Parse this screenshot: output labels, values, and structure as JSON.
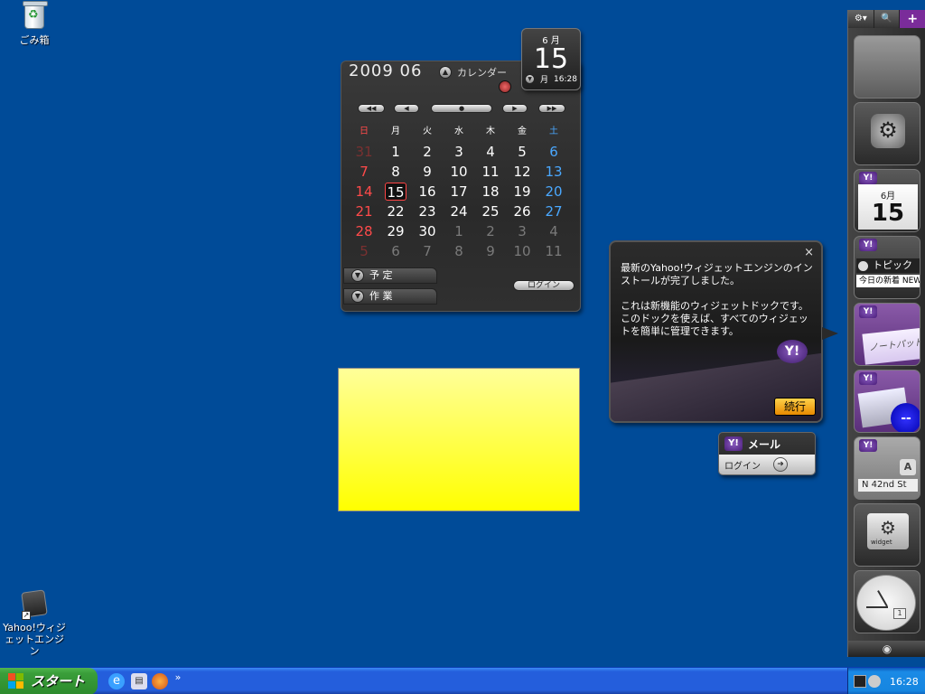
{
  "desktop": {
    "icons": [
      {
        "label": "ごみ箱",
        "icon": "recycle-bin-icon"
      },
      {
        "label": "Yahoo!ウィジェットエンジン",
        "icon": "yahoo-widgets-icon"
      }
    ]
  },
  "calendar": {
    "year_month": "2009 06",
    "mode_label": "カレンダー",
    "weekdays": [
      "日",
      "月",
      "火",
      "水",
      "木",
      "金",
      "土"
    ],
    "weeks": [
      [
        "31",
        "1",
        "2",
        "3",
        "4",
        "5",
        "6"
      ],
      [
        "7",
        "8",
        "9",
        "10",
        "11",
        "12",
        "13"
      ],
      [
        "14",
        "15",
        "16",
        "17",
        "18",
        "19",
        "20"
      ],
      [
        "21",
        "22",
        "23",
        "24",
        "25",
        "26",
        "27"
      ],
      [
        "28",
        "29",
        "30",
        "1",
        "2",
        "3",
        "4"
      ],
      [
        "5",
        "6",
        "7",
        "8",
        "9",
        "10",
        "11"
      ]
    ],
    "today": "15",
    "tab_schedule": "予 定",
    "tab_tasks": "作 業",
    "login_label": "ログイン",
    "colors": {
      "sunday": "#ff4a4a",
      "saturday": "#4aa8ff",
      "weekday": "#ffffff",
      "other_month": "#7a7a7a"
    }
  },
  "date_widget": {
    "month": "6 月",
    "day": "15",
    "weekday": "月",
    "time": "16:28"
  },
  "balloon": {
    "close": "×",
    "line1": "最新のYahoo!ウィジェットエンジンのインストールが完了しました。",
    "line2": "これは新機能のウィジェットドックです。このドックを使えば、すべてのウィジェットを簡単に管理できます。",
    "badge": "Y!",
    "continue_label": "続行"
  },
  "mail_widget": {
    "badge": "Y!",
    "title": "メール",
    "login_label": "ログイン"
  },
  "dock": {
    "toolbar": [
      "⚙▾",
      "🔍",
      "+"
    ],
    "items": [
      {
        "name": "blank-widget"
      },
      {
        "name": "widget-gallery"
      },
      {
        "name": "calendar-mini",
        "badge": "Y!",
        "month": "6月",
        "day": "15"
      },
      {
        "name": "topics",
        "badge": "Y!",
        "title": "トピックス",
        "sub": "今日の新着 NEW"
      },
      {
        "name": "notepad",
        "badge": "Y!",
        "label": "ノートパッド"
      },
      {
        "name": "weather",
        "badge": "Y!",
        "value": "--"
      },
      {
        "name": "maps",
        "badge": "Y!",
        "label": "N 42nd St",
        "tag": "A"
      },
      {
        "name": "widget-settings",
        "label": "widget"
      },
      {
        "name": "clock",
        "value": "1"
      }
    ]
  },
  "taskbar": {
    "start_label": "スタート",
    "quicklaunch_more": "»",
    "clock": "16:28"
  }
}
